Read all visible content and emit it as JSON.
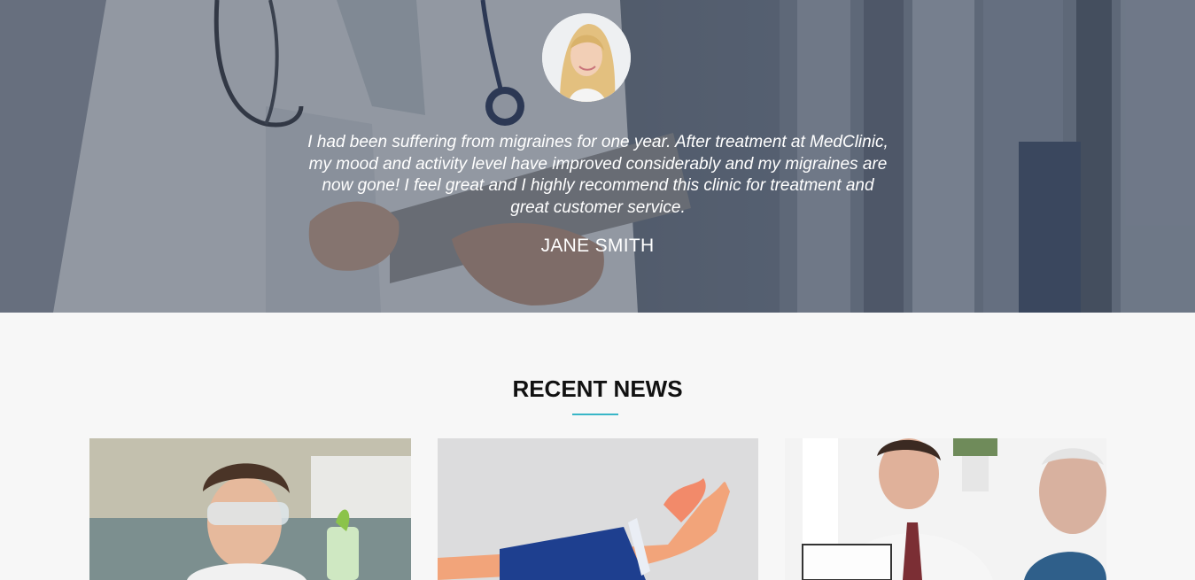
{
  "testimonial": {
    "quote": "I had been suffering from migraines for one year. After treatment at MedClinic, my mood and activity level have improved considerably and my migraines are now gone! I feel great and I highly recommend this clinic for treatment and great customer service.",
    "author": "JANE SMITH"
  },
  "news": {
    "title": "RECENT NEWS",
    "accent_color": "#38b6c7",
    "cards": [
      {
        "image": "lab-researcher-photo"
      },
      {
        "image": "wrist-brace-photo"
      },
      {
        "image": "doctor-patient-photo"
      }
    ]
  }
}
